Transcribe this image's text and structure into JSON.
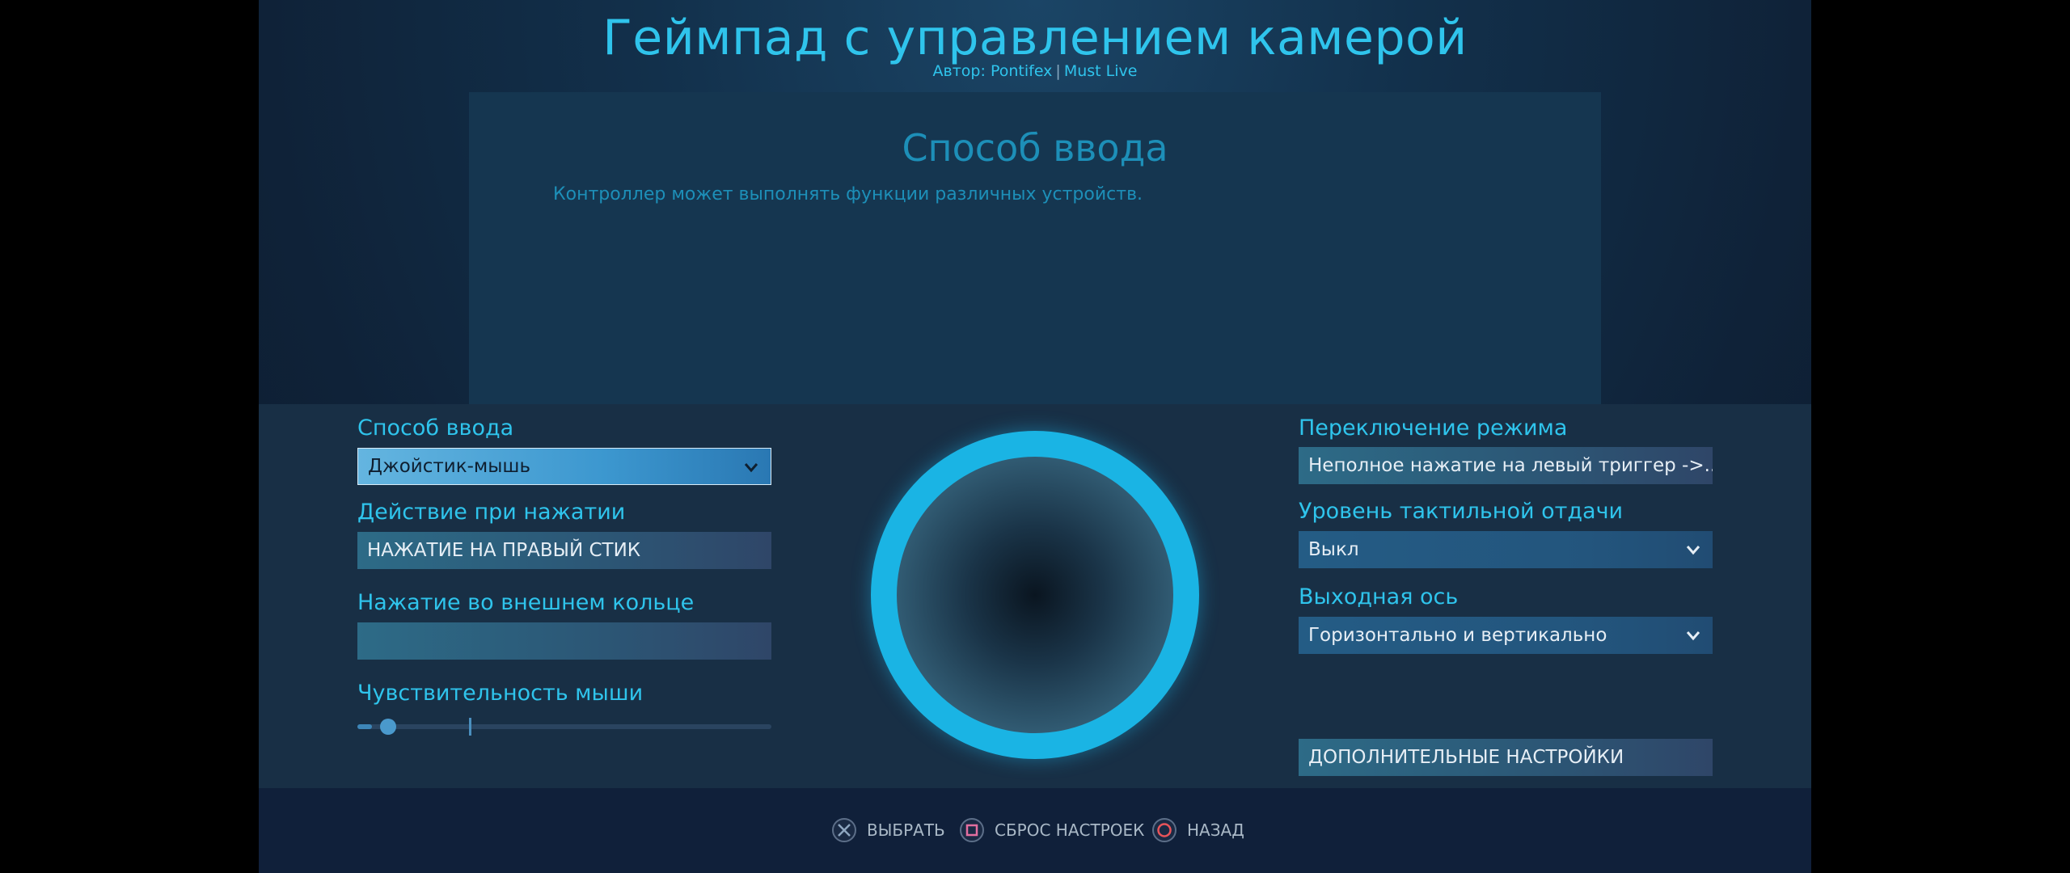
{
  "header": {
    "title": "Геймпад с управлением камерой",
    "author_prefix": "Автор:",
    "author_name": "Pontifex",
    "author_sep": "|",
    "author_group": "Must Live"
  },
  "description": {
    "title": "Способ ввода",
    "text": "Контроллер может выполнять функции различных устройств."
  },
  "left_settings": {
    "input_mode_label": "Способ ввода",
    "input_mode_value": "Джойстик-мышь",
    "click_action_label": "Действие при нажатии",
    "click_action_value": "НАЖАТИЕ НА ПРАВЫЙ СТИК",
    "outer_ring_label": "Нажатие во внешнем кольце",
    "outer_ring_value": "",
    "mouse_sens_label": "Чувствительность мыши",
    "mouse_sens_fraction": 0.035,
    "mouse_sens_default_fraction": 0.27
  },
  "right_settings": {
    "mode_shift_label": "Переключение режима",
    "mode_shift_value": "Неполное нажатие на левый триггер ->...",
    "haptic_label": "Уровень тактильной отдачи",
    "haptic_value": "Выкл",
    "output_axis_label": "Выходная ось",
    "output_axis_value": "Горизонтально и вертикально",
    "advanced_button": "ДОПОЛНИТЕЛЬНЫЕ НАСТРОЙКИ"
  },
  "footer": {
    "select_label": "ВЫБРАТЬ",
    "reset_label": "СБРОС НАСТРОЕК",
    "back_label": "НАЗАД",
    "select_icon": "cross-icon",
    "reset_icon": "square-icon",
    "back_icon": "circle-icon"
  },
  "colors": {
    "accent": "#2fc4ec",
    "trackpad_ring": "#1ab4e4",
    "panel": "#182f45",
    "cross": "#8ea6c0",
    "square": "#e36fa0",
    "circle": "#e8545a"
  }
}
